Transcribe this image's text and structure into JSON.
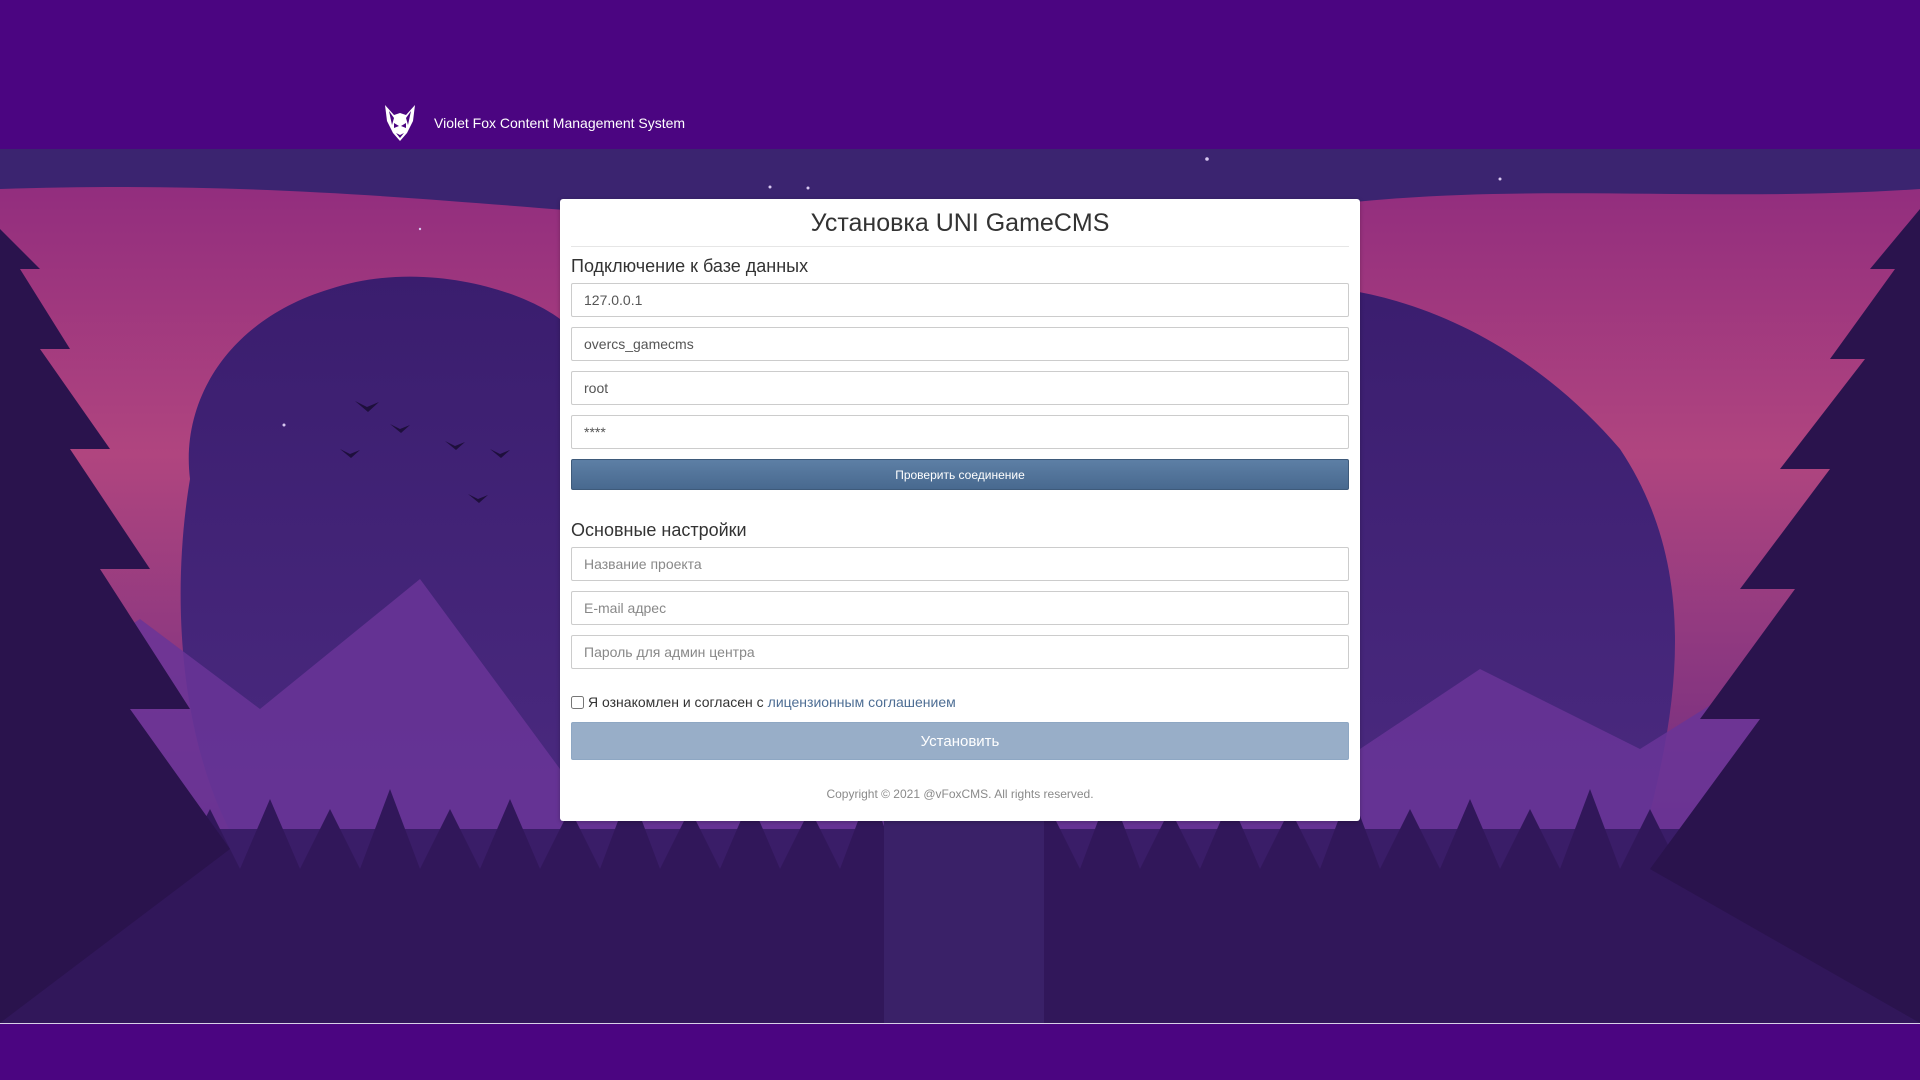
{
  "header": {
    "logo_icon": "violet-fox-logo-icon",
    "title": "Violet Fox Content Management System"
  },
  "installer": {
    "title": "Установка UNI GameCMS",
    "db_section": {
      "title": "Подключение к базе данных",
      "host_value": "127.0.0.1",
      "database_value": "overcs_gamecms",
      "user_value": "root",
      "password_value": "****",
      "check_button": "Проверить соединение"
    },
    "settings_section": {
      "title": "Основные настройки",
      "project_name_placeholder": "Название проекта",
      "email_placeholder": "E-mail адрес",
      "admin_password_placeholder": "Пароль для админ центра"
    },
    "agreement": {
      "checked": false,
      "text": "Я ознакомлен и согласен с",
      "link": "лицензионным соглашением"
    },
    "install_button": "Установить",
    "copyright": "Copyright © 2021 @vFoxCMS. All rights reserved."
  },
  "colors": {
    "header_bg": "#4b0581",
    "check_button": "#547599",
    "install_button": "#98aec8",
    "link": "#4e6e94"
  }
}
